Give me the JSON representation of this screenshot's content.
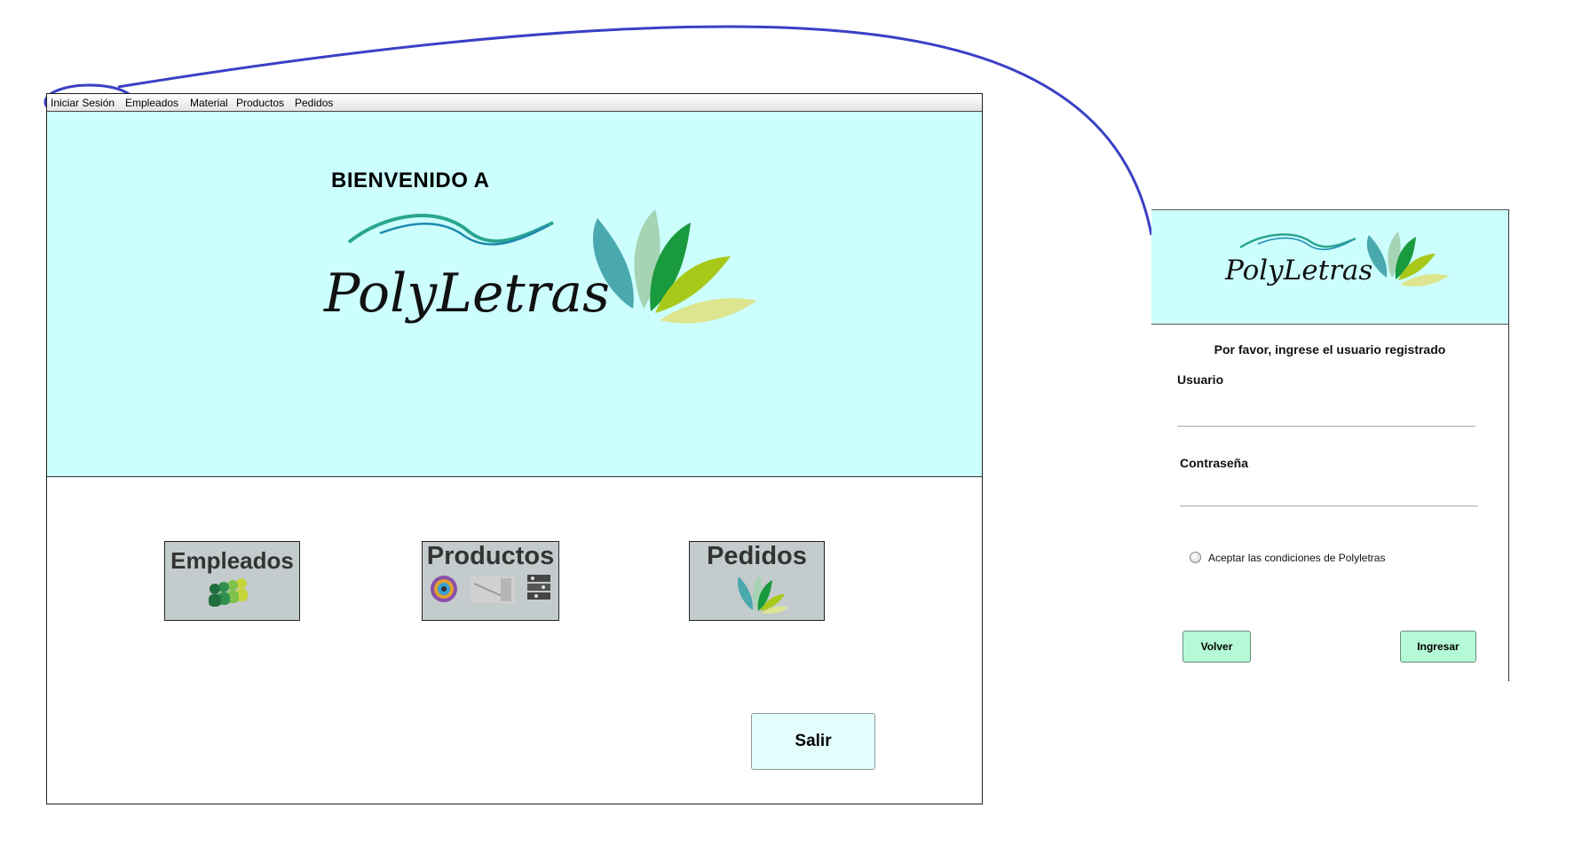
{
  "main_window": {
    "menu": [
      "Iniciar Sesión",
      "Empleados",
      "Material",
      "Productos",
      "Pedidos"
    ],
    "welcome": "BIENVENIDO A",
    "logo_text": "PolyLetras",
    "modules": {
      "empleados": "Empleados",
      "productos": "Productos",
      "pedidos": "Pedidos"
    },
    "exit_label": "Salir"
  },
  "login_dialog": {
    "logo_text": "PolyLetras",
    "prompt": "Por favor, ingrese el usuario registrado",
    "usuario_label": "Usuario",
    "usuario_value": "",
    "password_label": "Contraseña",
    "password_value": "",
    "accept_label": "Aceptar las condiciones de Polyletras",
    "back_label": "Volver",
    "submit_label": "Ingresar"
  },
  "colors": {
    "banner_bg": "#ccfefe",
    "module_bg": "#c3cbcc",
    "login_button_bg": "#b4fad7",
    "annotation_stroke": "#3a3fc4",
    "logo_greens": [
      "#4aa9ae",
      "#a7d3b5",
      "#1a9a3e",
      "#a9c91a",
      "#dde58e"
    ]
  }
}
